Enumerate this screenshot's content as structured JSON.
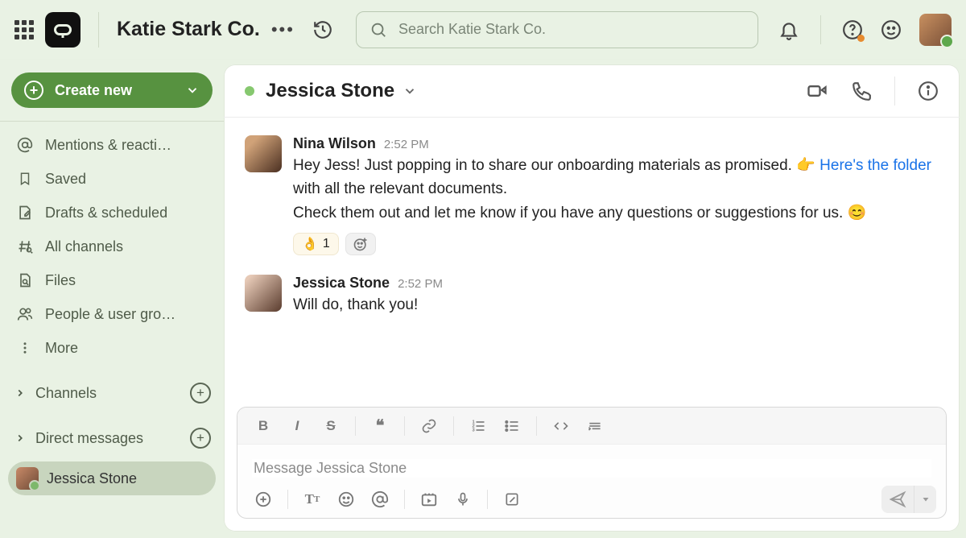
{
  "workspace": {
    "name": "Katie Stark Co."
  },
  "search": {
    "placeholder": "Search Katie Stark Co."
  },
  "create_button": {
    "label": "Create new"
  },
  "nav": {
    "mentions": "Mentions & reacti…",
    "saved": "Saved",
    "drafts": "Drafts & scheduled",
    "all_channels": "All channels",
    "files": "Files",
    "people": "People & user gro…",
    "more": "More"
  },
  "sections": {
    "channels": "Channels",
    "dms": "Direct messages"
  },
  "active_dm": {
    "name": "Jessica Stone"
  },
  "chat": {
    "title": "Jessica Stone",
    "messages": [
      {
        "sender": "Nina Wilson",
        "time": "2:52 PM",
        "text_pre": "Hey Jess! Just popping in to share our onboarding materials as promised. ",
        "point_emoji": "👉",
        "link_text": "Here's the folder",
        "text_mid": " with all the relevant documents.",
        "text_line2_pre": "Check them out and let me know if you have any questions or suggestions for us. ",
        "smile_emoji": "😊",
        "reaction_emoji": "👌",
        "reaction_count": "1"
      },
      {
        "sender": "Jessica Stone",
        "time": "2:52 PM",
        "text": "Will do, thank you!"
      }
    ]
  },
  "composer": {
    "placeholder": "Message Jessica Stone"
  }
}
